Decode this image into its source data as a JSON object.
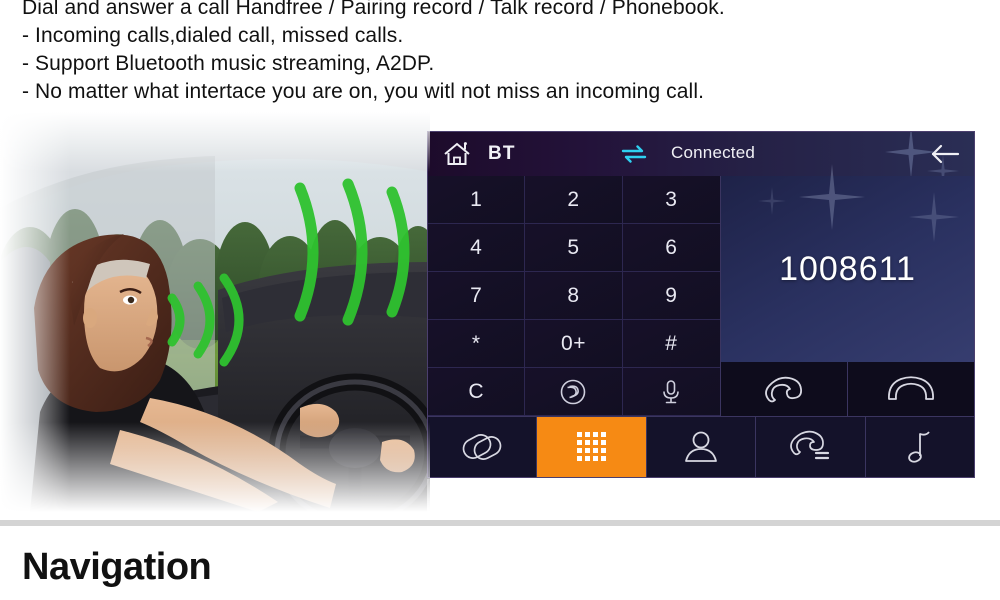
{
  "feature_text": {
    "lines": [
      "Dial and answer a call Handfree / Pairing record / Talk record / Phonebook.",
      "- Incoming calls,dialed call, missed calls.",
      "- Support Bluetooth music streaming, A2DP.",
      "- No matter what intertace you are on, you witl not miss an incoming call."
    ]
  },
  "photo": {
    "alt": "woman driving a car with green sound waves indicating hands-free voice call",
    "wave_color": "#2fc22f"
  },
  "device": {
    "header": {
      "home_icon": "home-icon",
      "title": "BT",
      "swap_icon": "bluetooth-transfer-icon",
      "swap_color": "#2fd0f0",
      "status": "Connected",
      "back_icon": "back-arrow-icon"
    },
    "keypad": {
      "keys": [
        {
          "label": "1",
          "name": "key-1"
        },
        {
          "label": "2",
          "name": "key-2"
        },
        {
          "label": "3",
          "name": "key-3"
        },
        {
          "label": "4",
          "name": "key-4"
        },
        {
          "label": "5",
          "name": "key-5"
        },
        {
          "label": "6",
          "name": "key-6"
        },
        {
          "label": "7",
          "name": "key-7"
        },
        {
          "label": "8",
          "name": "key-8"
        },
        {
          "label": "9",
          "name": "key-9"
        },
        {
          "label": "*",
          "name": "key-star"
        },
        {
          "label": "0+",
          "name": "key-0-plus"
        },
        {
          "label": "#",
          "name": "key-hash"
        },
        {
          "label": "C",
          "name": "key-clear"
        },
        {
          "label": "",
          "name": "key-audio-transfer",
          "icon": "audio-transfer-icon"
        },
        {
          "label": "",
          "name": "key-microphone",
          "icon": "microphone-icon"
        }
      ]
    },
    "display": {
      "number": "1008611",
      "call_button": "call-icon",
      "hangup_button": "hangup-icon"
    },
    "tabs": [
      {
        "name": "tab-pairing",
        "icon": "link-rings-icon",
        "active": false
      },
      {
        "name": "tab-keypad",
        "icon": "keypad-grid-icon",
        "active": true
      },
      {
        "name": "tab-contacts",
        "icon": "person-icon",
        "active": false
      },
      {
        "name": "tab-call-records",
        "icon": "call-records-icon",
        "active": false
      },
      {
        "name": "tab-music",
        "icon": "music-note-icon",
        "active": false
      }
    ],
    "colors": {
      "accent": "#f68a14",
      "panel_dark": "#0c0a1a",
      "display_blue": "#2a3160",
      "header_purple": "#231239",
      "icon_stroke": "#dcdce6"
    }
  },
  "bottom": {
    "section_title": "Navigation"
  }
}
